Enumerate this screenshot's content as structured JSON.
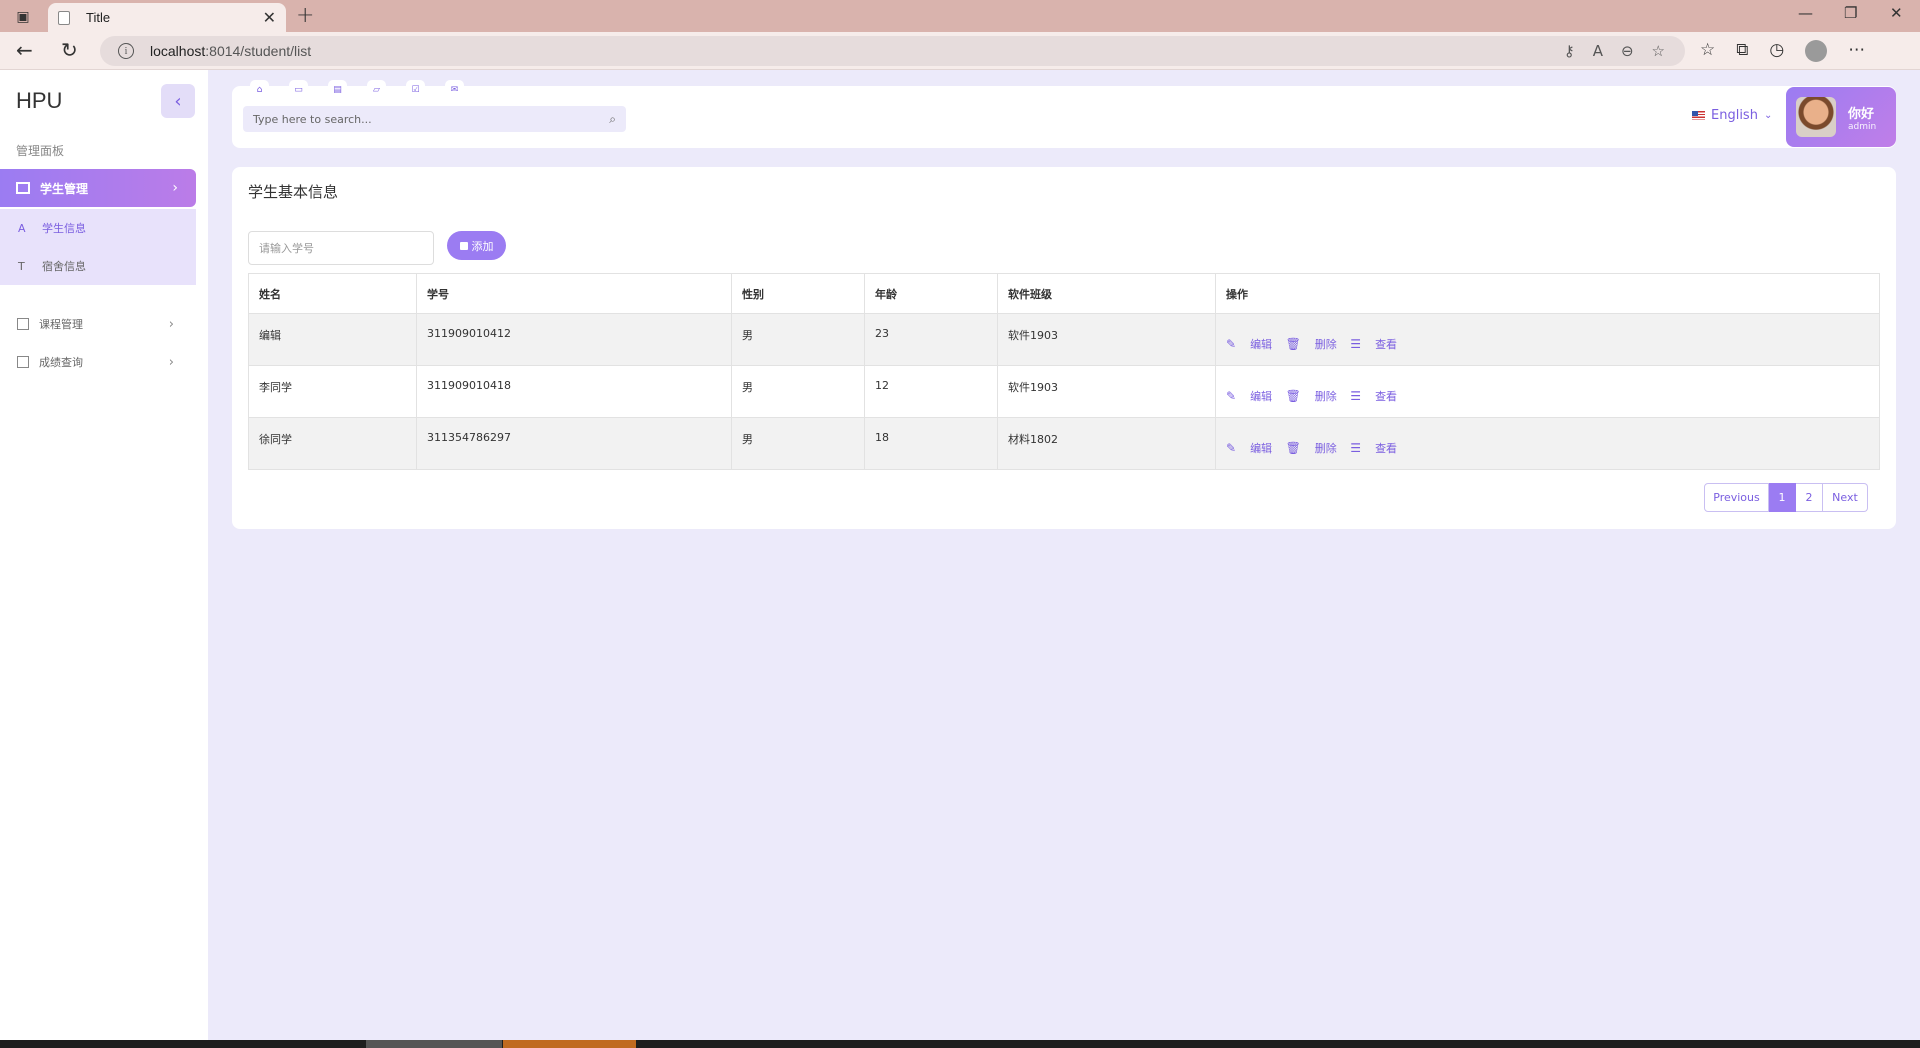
{
  "browser": {
    "tab_title": "Title",
    "url_host": "localhost",
    "url_rest": ":8014/student/list"
  },
  "sidebar": {
    "logo": "HPU",
    "section_label": "管理面板",
    "active_menu": "学生管理",
    "submenu": [
      {
        "label": "学生信息",
        "icon": "A"
      },
      {
        "label": "宿舍信息",
        "icon": "T"
      }
    ],
    "menus": [
      {
        "label": "课程管理"
      },
      {
        "label": "成绩查询"
      }
    ]
  },
  "header": {
    "search_placeholder": "Type here to search...",
    "language": "English",
    "greeting": "你好",
    "role": "admin"
  },
  "main": {
    "title": "学生基本信息",
    "id_placeholder": "请输入学号",
    "add_label": "添加",
    "columns": [
      "姓名",
      "学号",
      "性别",
      "年龄",
      "软件班级",
      "操作"
    ],
    "rows": [
      {
        "name": "编辑",
        "id": "311909010412",
        "gender": "男",
        "age": "23",
        "class": "软件1903"
      },
      {
        "name": "李同学",
        "id": "311909010418",
        "gender": "男",
        "age": "12",
        "class": "软件1903"
      },
      {
        "name": "徐同学",
        "id": "311354786297",
        "gender": "男",
        "age": "18",
        "class": "材料1802"
      }
    ],
    "actions": {
      "edit": "编辑",
      "delete": "删除",
      "view": "查看"
    },
    "pagination": {
      "prev": "Previous",
      "pages": [
        "1",
        "2"
      ],
      "next": "Next",
      "current": "1"
    }
  }
}
